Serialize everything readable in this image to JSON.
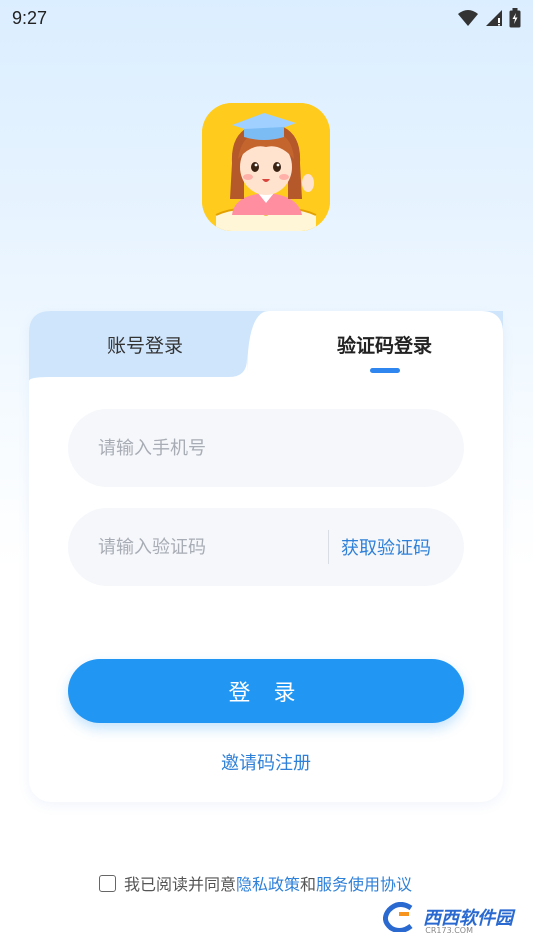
{
  "status_bar": {
    "time": "9:27",
    "icons": [
      "wifi-icon",
      "signal-icon",
      "battery-icon"
    ]
  },
  "app": {
    "logo": "girl-with-graduation-cap-logo"
  },
  "tabs": [
    {
      "label": "账号登录",
      "active": false
    },
    {
      "label": "验证码登录",
      "active": true
    }
  ],
  "form": {
    "phone_placeholder": "请输入手机号",
    "code_placeholder": "请输入验证码",
    "get_code_label": "获取验证码",
    "login_label": "登 录",
    "invite_label": "邀请码注册"
  },
  "agreement": {
    "prefix": "我已阅读并同意",
    "privacy_link": "隐私政策",
    "and": "和",
    "service_link": "服务使用协议",
    "checked": false
  },
  "watermark": {
    "text": "西西软件园",
    "sub": "CR173.COM"
  },
  "colors": {
    "accent": "#2196f3",
    "link": "#2f80d8",
    "tab_bg": "#cfe5fc",
    "logo_bg": "#ffcc1e"
  }
}
